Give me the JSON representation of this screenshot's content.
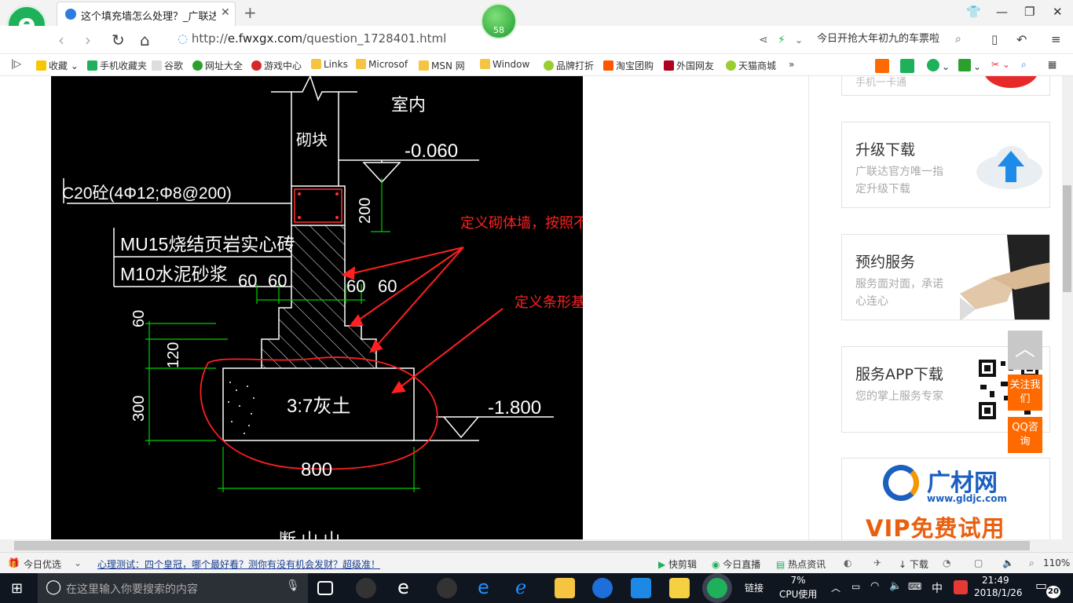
{
  "browser": {
    "tab_title": "这个填充墙怎么处理？_广联达服",
    "badge_count": "58",
    "address": {
      "prefix": "http://",
      "host": "e.fwxgx.com",
      "path": "/question_1728401.html"
    },
    "search_text": "今日开抢大年初九的车票啦",
    "bookmarks": [
      "收藏",
      "手机收藏夹",
      "谷歌",
      "网址大全",
      "游戏中心",
      "Links",
      "Microsof",
      "MSN 网",
      "Window",
      "品牌打折",
      "淘宝团购",
      "外国网友",
      "天猫商城"
    ],
    "bookmark_more": "»"
  },
  "cad": {
    "label_indoor": "室内",
    "label_block": "砌块",
    "level_top": "-0.060",
    "beam_spec": "C20砼(4Φ12;Φ8@200)",
    "dim_200": "200",
    "brick_line1": "MU15烧结页岩实心砖",
    "brick_line2": "M10水泥砂浆",
    "dim_60a": "60",
    "dim_60b": "60",
    "dim_60c": "60",
    "dim_60d": "60",
    "dim_60v": "60",
    "dim_120": "120",
    "dim_300": "300",
    "footing_text": "3:7灰土",
    "level_bottom": "-1.800",
    "dim_800": "800",
    "note_wall": "定义砌体墙，按照不同标高和宽度定义",
    "note_footing": "定义条形基础",
    "cut_text": "断 山 山"
  },
  "sidebar": {
    "partial_card": "手机一卡通",
    "cards": [
      {
        "title": "升级下载",
        "subtitle": "广联达官方唯一指定升级下载"
      },
      {
        "title": "预约服务",
        "subtitle": "服务面对面，承诺心连心"
      },
      {
        "title": "服务APP下载",
        "subtitle": "您的掌上服务专家"
      }
    ],
    "ad_brand": "广材网",
    "ad_url": "www.gldjc.com",
    "ad_slogan": "VIP免费试用",
    "float": {
      "top": "︿",
      "follow": "关注我们",
      "qq": "QQ咨询"
    }
  },
  "statusbar": {
    "left": "今日优选",
    "news": "心理测试：四个皇冠，哪个最好看？测你有没有机会发财？超级准！",
    "items": [
      "快剪辑",
      "今日直播",
      "热点资讯",
      "下载"
    ],
    "zoom": "110%"
  },
  "taskbar": {
    "search_placeholder": "在这里输入你要搜索的内容",
    "links": "链接",
    "cpu_percent": "7%",
    "cpu_label": "CPU使用",
    "ime": "中",
    "time": "21:49",
    "date": "2018/1/26",
    "notifications": "20"
  },
  "colors": {
    "annotation": "#ff2020",
    "dim_green": "#00d000",
    "accent": "#1fb15a"
  }
}
